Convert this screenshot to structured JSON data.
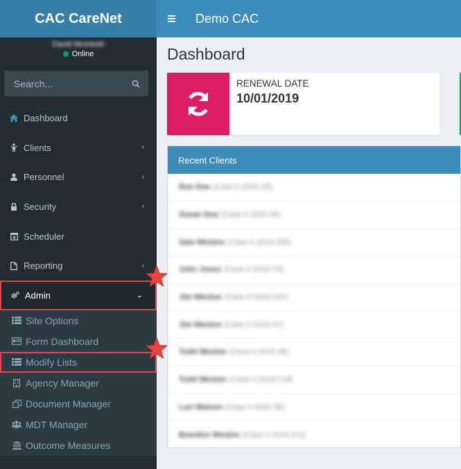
{
  "brand": "CAC CareNet",
  "user": {
    "name": "David Mcintosh",
    "status": "Online"
  },
  "search": {
    "placeholder": "Search..."
  },
  "menu": [
    {
      "label": "Dashboard",
      "icon": "home-icon",
      "chevron": false
    },
    {
      "label": "Clients",
      "icon": "child-icon",
      "chevron": true
    },
    {
      "label": "Personnel",
      "icon": "user-icon",
      "chevron": true
    },
    {
      "label": "Security",
      "icon": "lock-icon",
      "chevron": true
    },
    {
      "label": "Scheduler",
      "icon": "calendar-plus-icon",
      "chevron": false
    },
    {
      "label": "Reporting",
      "icon": "file-icon",
      "chevron": true
    },
    {
      "label": "Admin",
      "icon": "cogs-icon",
      "chevron": true,
      "expanded": true
    }
  ],
  "submenu": [
    {
      "label": "Site Options",
      "icon": "list-icon"
    },
    {
      "label": "Form Dashboard",
      "icon": "id-card-icon"
    },
    {
      "label": "Modify Lists",
      "icon": "list-icon"
    },
    {
      "label": "Agency Manager",
      "icon": "building-icon"
    },
    {
      "label": "Document Manager",
      "icon": "copy-icon"
    },
    {
      "label": "MDT Manager",
      "icon": "users-icon"
    },
    {
      "label": "Outcome Measures",
      "icon": "bank-icon"
    }
  ],
  "topbar": {
    "title": "Demo CAC"
  },
  "page": {
    "title": "Dashboard"
  },
  "renewal": {
    "label": "RENEWAL DATE",
    "value": "10/01/2019",
    "color": "#dd1c63"
  },
  "recent_clients": {
    "title": "Recent Clients",
    "rows": [
      {
        "name": "Ron Doe",
        "case": "(Case # 2020-35)"
      },
      {
        "name": "Susan Doe",
        "case": "(Case # 2020-34)"
      },
      {
        "name": "Sam Weston",
        "case": "(Case # 2019-256)"
      },
      {
        "name": "John Jones",
        "case": "(Case # 2019-73)"
      },
      {
        "name": "Jim Weston",
        "case": "(Case # 2019-241)"
      },
      {
        "name": "Jim Weston",
        "case": "(Case # 2020-47)"
      },
      {
        "name": "Todd Weston",
        "case": "(Case # 2020-48)"
      },
      {
        "name": "Todd Weston",
        "case": "(Case # 2019-218)"
      },
      {
        "name": "Lori Watson",
        "case": "(Case # 2020-36)"
      },
      {
        "name": "Brandon Weston",
        "case": "(Case # 2019-221)"
      }
    ]
  },
  "colors": {
    "sidebar": "#222d32",
    "header": "#3c8dbc",
    "brand": "#367fa9",
    "highlight": "#e04646"
  }
}
